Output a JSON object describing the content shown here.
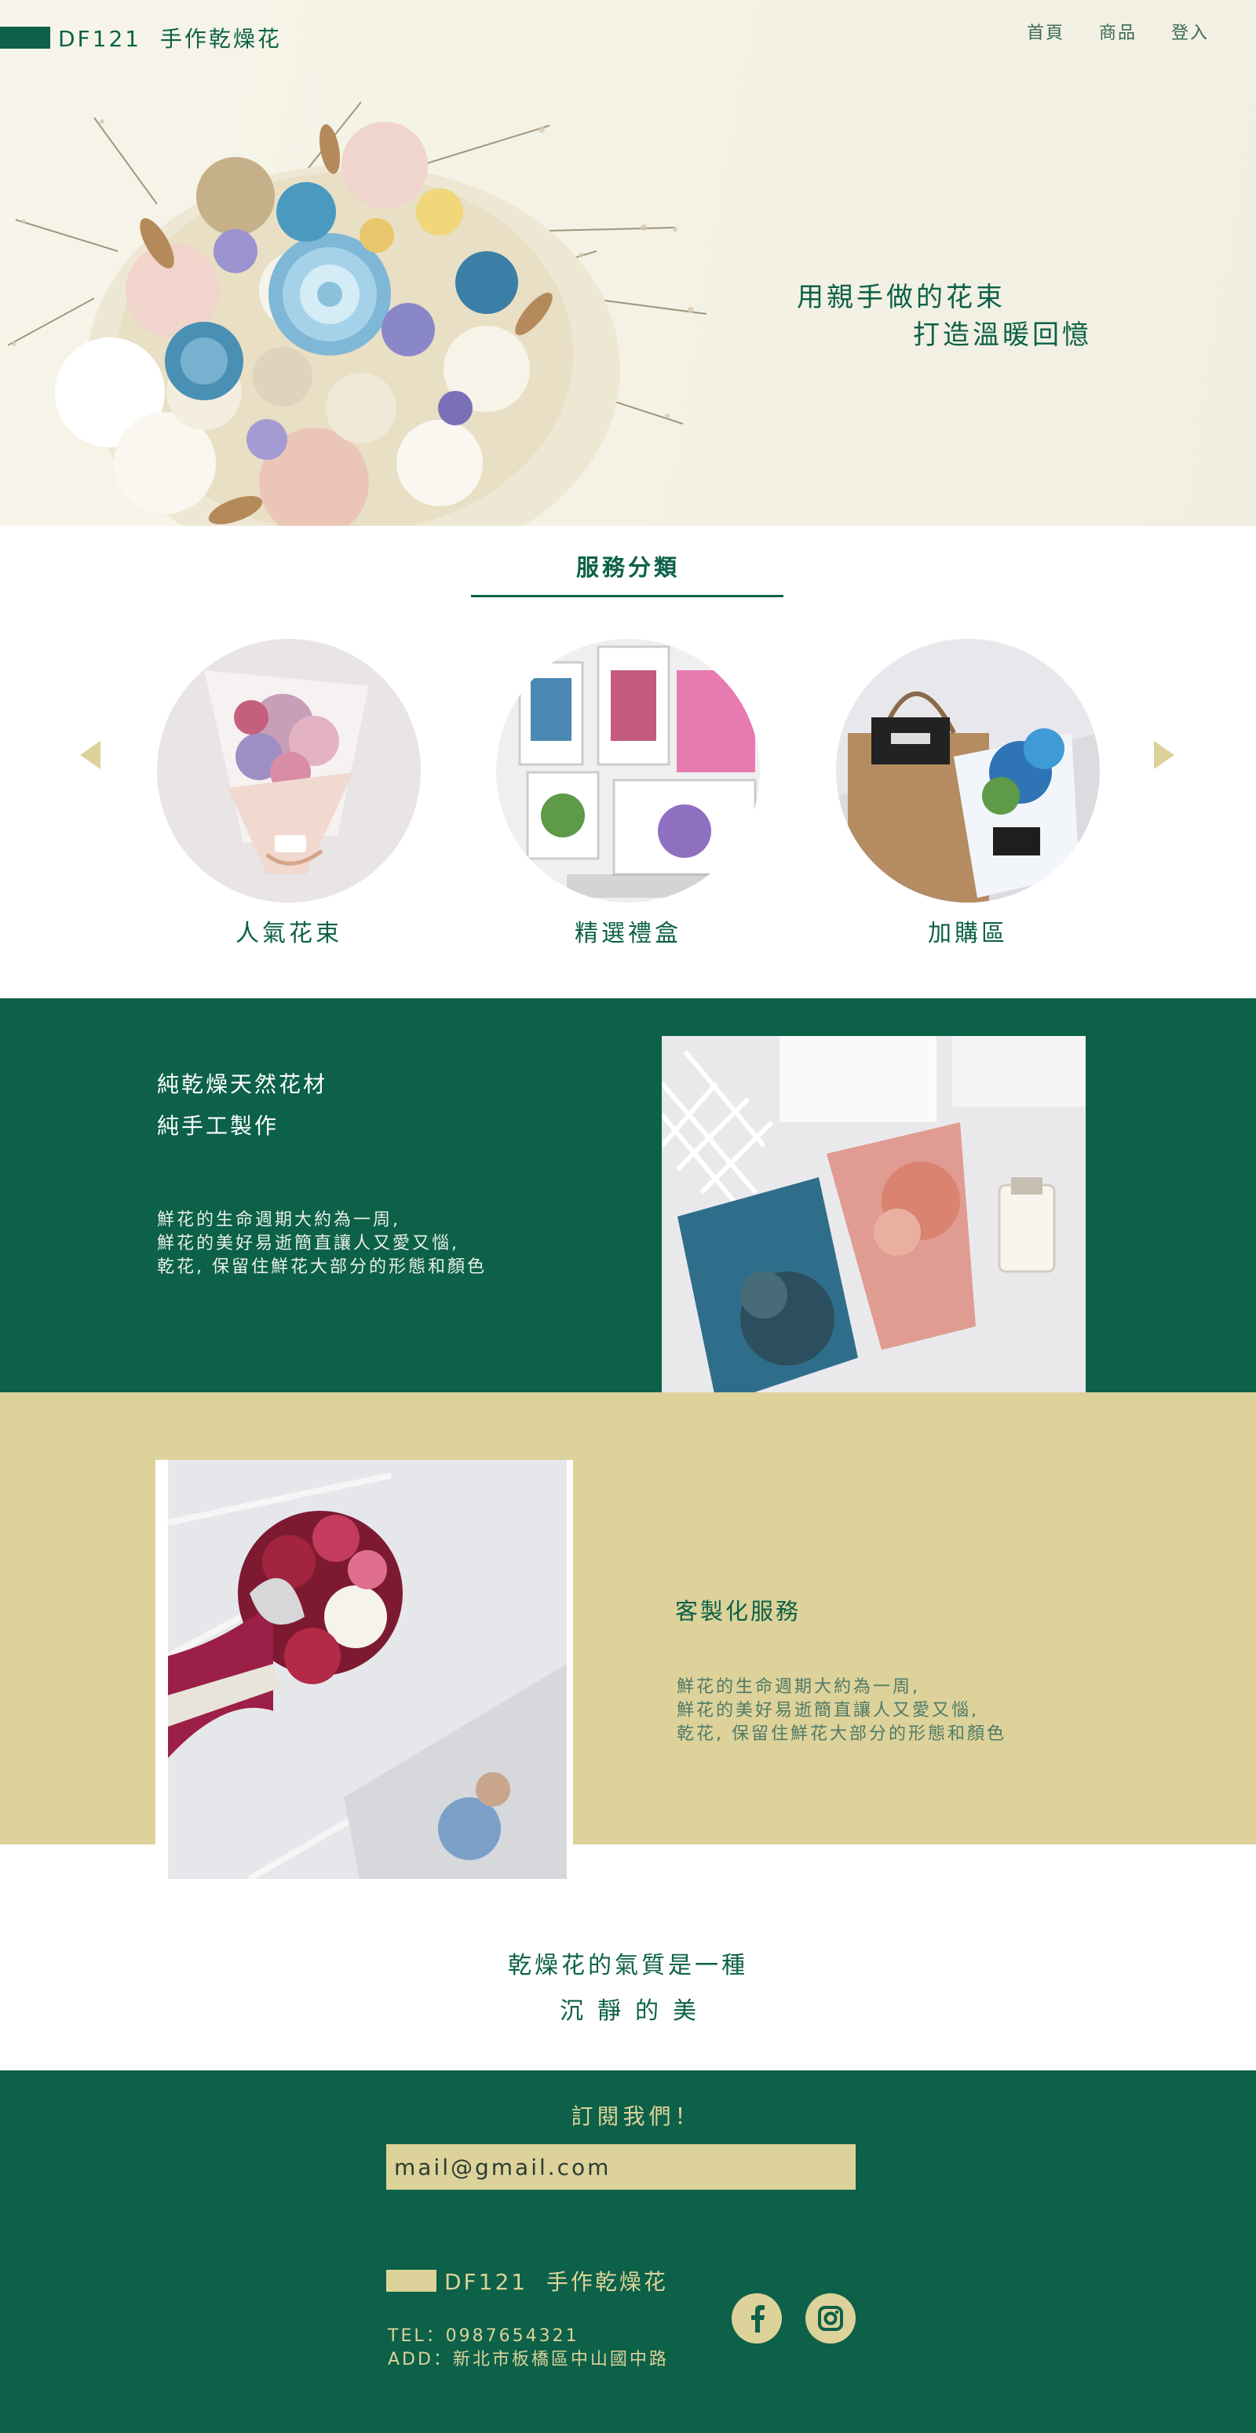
{
  "brand": {
    "name": "DF121",
    "tagline": "手作乾燥花"
  },
  "nav": [
    "首頁",
    "商品",
    "登入"
  ],
  "hero": {
    "line1": "用親手做的花束",
    "line2": "打造溫暖回憶"
  },
  "services": {
    "title": "服務分類",
    "categories": [
      "人氣花束",
      "精選禮盒",
      "加購區"
    ]
  },
  "feature1": {
    "heading_line1": "純乾燥天然花材",
    "heading_line2": "純手工製作",
    "desc_line1": "鮮花的生命週期大約為一周,",
    "desc_line2": "鮮花的美好易逝簡直讓人又愛又惱,",
    "desc_line3": "乾花, 保留住鮮花大部分的形態和顏色"
  },
  "feature2": {
    "heading": "客製化服務",
    "desc_line1": "鮮花的生命週期大約為一周,",
    "desc_line2": "鮮花的美好易逝簡直讓人又愛又惱,",
    "desc_line3": "乾花, 保留住鮮花大部分的形態和顏色"
  },
  "quote": {
    "line1": "乾燥花的氣質是一種",
    "line2": "沉靜的美"
  },
  "footer": {
    "subscribe_title": "訂閱我們！",
    "email_value": "mail@gmail.com",
    "brand_name": "DF121",
    "brand_tagline": "手作乾燥花",
    "tel": "TEL：0987654321",
    "address": "ADD：新北市板橋區中山國中路"
  },
  "icons": {
    "facebook": "facebook-icon",
    "instagram": "instagram-icon",
    "prev": "arrow-left-icon",
    "next": "arrow-right-icon"
  },
  "colors": {
    "primary_green": "#0c6148",
    "accent_beige": "#ddd29a",
    "background": "#ffffff"
  }
}
